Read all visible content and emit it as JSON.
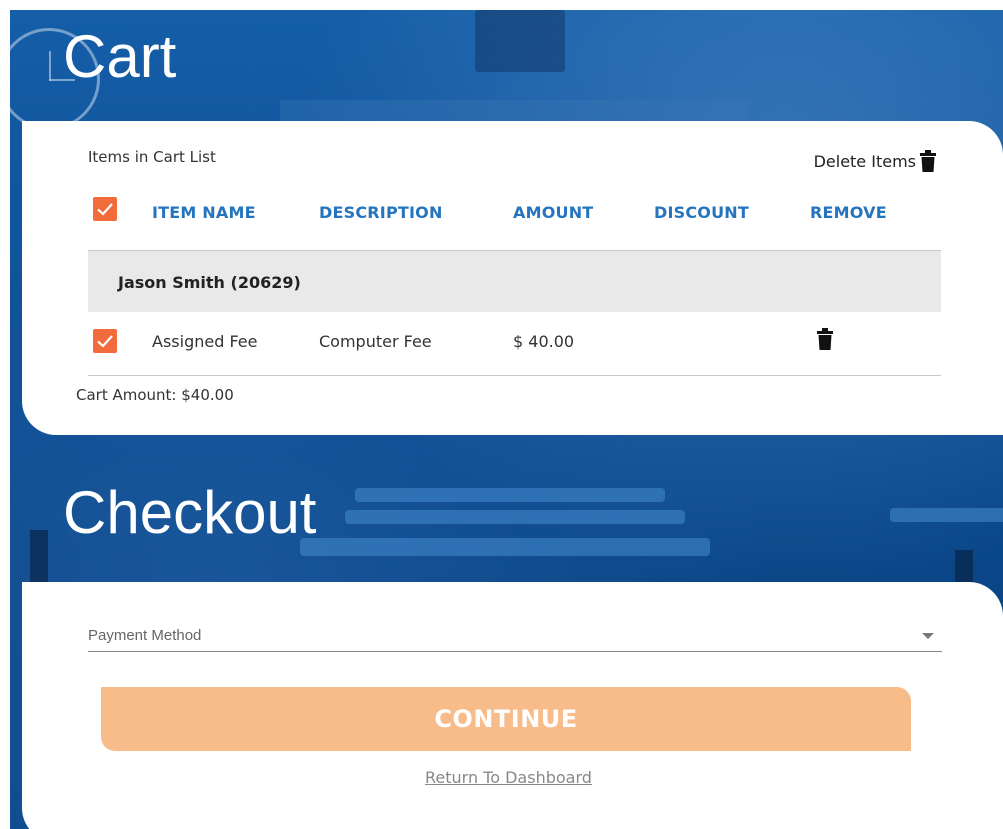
{
  "cart": {
    "title": "Cart",
    "list_label": "Items in Cart List",
    "delete_items_label": "Delete Items",
    "columns": [
      "ITEM NAME",
      "DESCRIPTION",
      "AMOUNT",
      "DISCOUNT",
      "REMOVE"
    ],
    "groups": [
      {
        "student": "Jason Smith (20629)",
        "items": [
          {
            "checked": true,
            "item_name": "Assigned Fee",
            "description": "Computer Fee",
            "amount": "$ 40.00",
            "discount": ""
          }
        ]
      }
    ],
    "cart_amount": "Cart Amount: $40.00"
  },
  "checkout": {
    "title": "Checkout",
    "payment_method_placeholder": "Payment Method",
    "continue_label": "CONTINUE",
    "return_label": "Return To Dashboard"
  },
  "colors": {
    "accent_blue": "#2574be",
    "checkbox_orange": "#f26b3a",
    "continue_disabled": "#f8bb8a",
    "background_blue": "#0d4f95"
  }
}
